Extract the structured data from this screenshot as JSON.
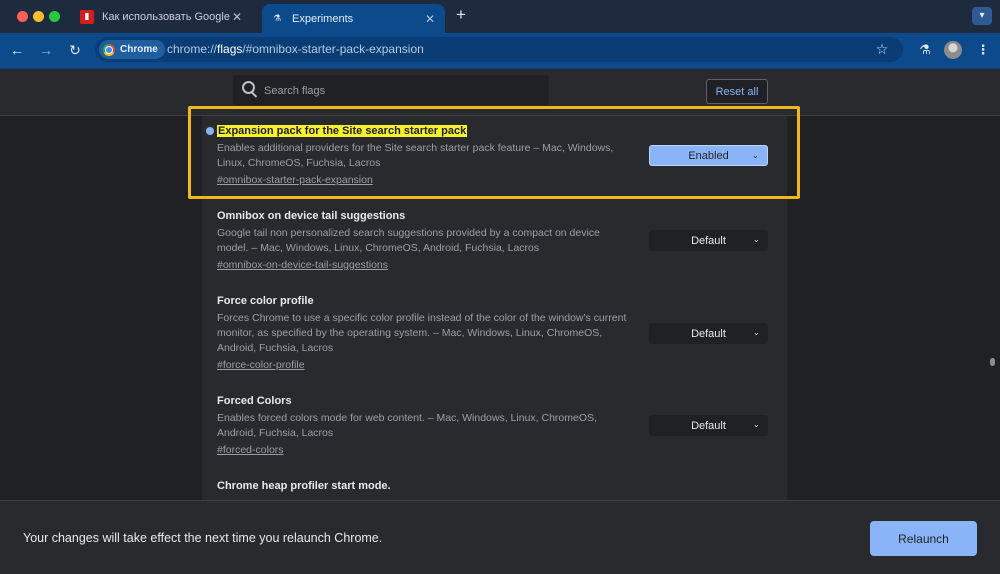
{
  "window": {
    "tabs": [
      {
        "title": "Как использовать Google Ge",
        "icon": "red-document-icon",
        "active": false
      },
      {
        "title": "Experiments",
        "icon": "flask-icon",
        "active": true
      }
    ]
  },
  "toolbar": {
    "site_chip": "Chrome",
    "url_prefix": "chrome://",
    "url_host": "flags",
    "url_rest": "/#omnibox-starter-pack-expansion"
  },
  "flags_header": {
    "search_placeholder": "Search flags",
    "reset_label": "Reset all"
  },
  "flags": [
    {
      "name": "Expansion pack for the Site search starter pack",
      "description": "Enables additional providers for the Site search starter pack feature – Mac, Windows, Linux, ChromeOS, Fuchsia, Lacros",
      "link": "#omnibox-starter-pack-expansion",
      "value": "Enabled",
      "modified": true,
      "highlighted": true
    },
    {
      "name": "Omnibox on device tail suggestions",
      "description": "Google tail non personalized search suggestions provided by a compact on device model. – Mac, Windows, Linux, ChromeOS, Android, Fuchsia, Lacros",
      "link": "#omnibox-on-device-tail-suggestions",
      "value": "Default",
      "modified": false
    },
    {
      "name": "Force color profile",
      "description": "Forces Chrome to use a specific color profile instead of the color of the window's current monitor, as specified by the operating system. – Mac, Windows, Linux, ChromeOS, Android, Fuchsia, Lacros",
      "link": "#force-color-profile",
      "value": "Default",
      "modified": false
    },
    {
      "name": "Forced Colors",
      "description": "Enables forced colors mode for web content. – Mac, Windows, Linux, ChromeOS, Android, Fuchsia, Lacros",
      "link": "#forced-colors",
      "value": "Default",
      "modified": false
    },
    {
      "name": "Chrome heap profiler start mode.",
      "modified": false
    }
  ],
  "relaunch": {
    "message": "Your changes will take effect the next time you relaunch Chrome.",
    "button_label": "Relaunch"
  },
  "colors": {
    "accent": "#8ab4f8",
    "highlight": "#f6f22c",
    "frame": "#f0b81c",
    "toolbar": "#0c4a8c"
  }
}
